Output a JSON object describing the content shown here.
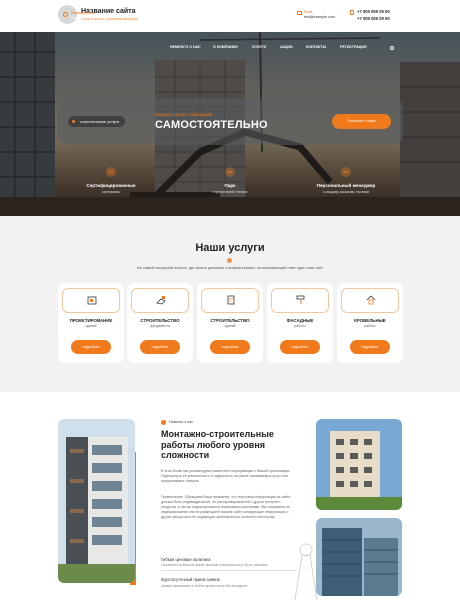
{
  "header": {
    "title": "Название сайта",
    "subtitle": "Строительство, строительные услуги",
    "email_label": "Email",
    "email": "test@example.com",
    "phone_1": "+7 000 000 00 00",
    "phone_2": "+7 000 000 00 00"
  },
  "hero": {
    "hours_label": "Режим работы",
    "hours": "Пн-Пт с 9:00 до 19:00",
    "nav": [
      "Немного о нас",
      "О компании",
      "Услуги",
      "Акции",
      "Контакты",
      "Регистрация"
    ],
    "tag": "строительные услуги",
    "small_text": "Каждый проект ломающий",
    "big_text": "САМОСТОЯТЕЛЬНО",
    "cta": "Оплатите с нами",
    "features": [
      {
        "num": "01",
        "title": "Сертифицированные",
        "sub": "материалы"
      },
      {
        "num": "02",
        "title": "Парк",
        "sub": "строительной техники"
      },
      {
        "num": "03",
        "title": "Персональный менеджер",
        "sub": "к каждому заказчику на связи"
      }
    ]
  },
  "services": {
    "heading": "Наши услуги",
    "description": "На самый насущный вопрос, где купить дешевые стройматериалы, исчерпывающий ответ дает наш сайт",
    "cards": [
      {
        "title": "ПРОЕКТИРОВАНИЕ",
        "sub": "зданий",
        "button": "подробнее"
      },
      {
        "title": "СТРОИТЕЛЬСТВО",
        "sub": "фундамента",
        "button": "подробнее"
      },
      {
        "title": "СТРОИТЕЛЬСТВО",
        "sub": "зданий",
        "button": "подробнее"
      },
      {
        "title": "ФАСАДНЫЕ",
        "sub": "работы",
        "button": "подробнее"
      },
      {
        "title": "КРОВЕЛЬНЫЕ",
        "sub": "работы",
        "button": "подробнее"
      }
    ]
  },
  "about": {
    "tag": "Немного о нас",
    "title": "Монтажно-строительные работы любого уровня сложности",
    "p1": "В этом блоке мы рекомендуем разместить информацию о Вашей организации. Подчеркнуть ее уникальность и надежность на рынке оказываемых услуг или предлагаемых товаров.",
    "p2": "Привлечение. Обращаем Ваше внимание, что текстовая информация на сайте должна быть индивидуальной, не растиражированной с других интернет-ресурсов, а так же индексироваться поисковыми системами. Мы отправили на индексирование или не размещаете вашем сайте копирующие информации с других ресурсов и не создающую оригинального контента или ссылку",
    "features": [
      {
        "title": "Гибкая ценовая политика",
        "sub": "Снижение на Ваш интернет-магазин компании могут быть разными"
      },
      {
        "title": "Круглосуточный прием заявок",
        "sub": "Заявки принимаем в любое время суток без выходных"
      }
    ]
  },
  "colors": {
    "accent": "#f07a1c"
  }
}
